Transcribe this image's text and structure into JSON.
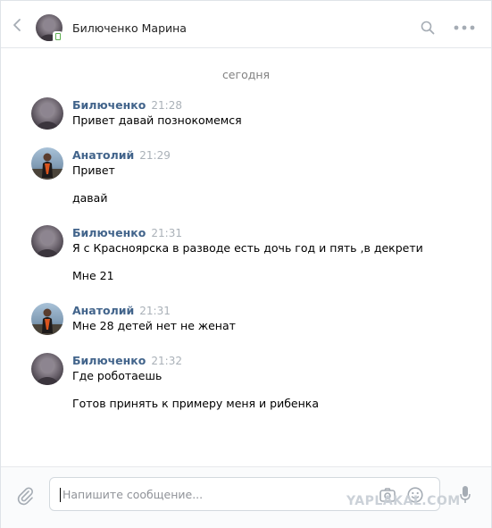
{
  "header": {
    "contact_name": "Билюченко Марина",
    "back_icon": "chevron-left-icon",
    "search_icon": "search-icon",
    "more_icon": "more-horizontal-icon",
    "status_icon": "mobile-online-icon"
  },
  "date_separator": "сегодня",
  "messages": [
    {
      "author": "Билюченко",
      "time": "21:28",
      "avatar": "avatar-female-icon",
      "lines": [
        "Привет давай познокомемся"
      ]
    },
    {
      "author": "Анатолий",
      "time": "21:29",
      "avatar": "avatar-male-icon",
      "lines": [
        "Привет",
        "давай"
      ]
    },
    {
      "author": "Билюченко",
      "time": "21:31",
      "avatar": "avatar-female-icon",
      "lines": [
        "Я с Красноярска в разводе есть дочь год и пять ,в декрети",
        "Мне 21"
      ]
    },
    {
      "author": "Анатолий",
      "time": "21:31",
      "avatar": "avatar-male-icon",
      "lines": [
        "Мне 28 детей нет не женат"
      ]
    },
    {
      "author": "Билюченко",
      "time": "21:32",
      "avatar": "avatar-female-icon",
      "lines": [
        "Где роботаешь",
        "Готов принять к примеру меня и рибенка"
      ]
    }
  ],
  "composer": {
    "placeholder": "Напишите сообщение...",
    "value": ""
  },
  "watermark": "YAPLAKAL.COM",
  "colors": {
    "author": "#42648b",
    "time": "#aab1b8",
    "online": "#5fb053",
    "icon": "#a5acb4"
  }
}
